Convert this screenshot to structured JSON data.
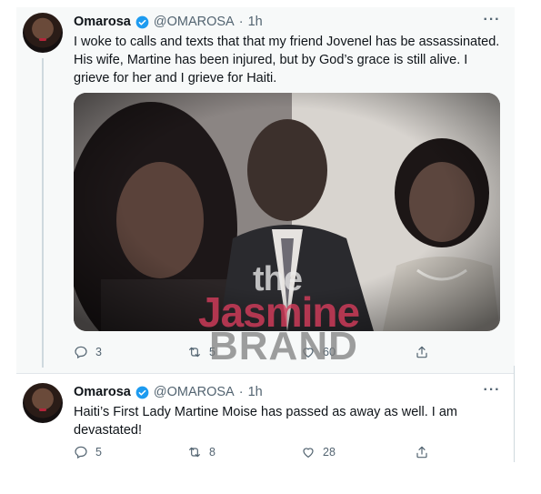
{
  "tweets": [
    {
      "name": "Omarosa",
      "handle": "@OMAROSA",
      "separator": "·",
      "time": "1h",
      "more": "···",
      "text": "I woke to calls and texts that that my friend Jovenel has be assassinated. His wife, Martine has been injured, but by God’s grace is still alive. I grieve for her and I grieve for Haiti.",
      "media": "photo-three-people",
      "actions": {
        "reply_count": "3",
        "retweet_count": "5",
        "like_count": "60",
        "share": ""
      }
    },
    {
      "name": "Omarosa",
      "handle": "@OMAROSA",
      "separator": "·",
      "time": "1h",
      "more": "···",
      "text": "Haiti’s First Lady Martine Moise has passed as away as well. I am devastated!",
      "actions": {
        "reply_count": "5",
        "retweet_count": "8",
        "like_count": "28",
        "share": ""
      }
    }
  ],
  "watermark": {
    "line1": "the",
    "line2": "Jasmine",
    "line3": "BRAND"
  },
  "colors": {
    "text": "#0f1419",
    "secondary": "#536471",
    "verified": "#1d9bf0",
    "thread_bg": "#f7f9f9",
    "watermark_pink": "#d23c5a"
  },
  "icons": [
    "verified-badge-icon",
    "more-icon",
    "reply-icon",
    "retweet-icon",
    "like-icon",
    "share-icon"
  ]
}
